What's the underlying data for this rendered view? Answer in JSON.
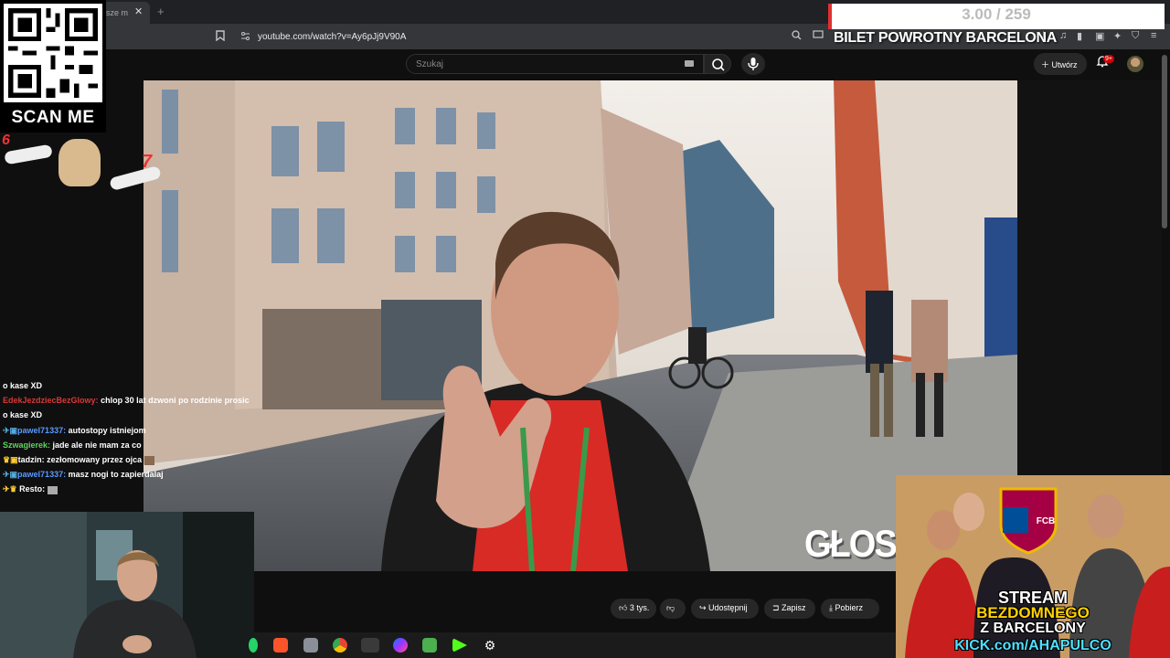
{
  "browser": {
    "tab_title": "sze m",
    "url": "youtube.com/watch?v=Ay6pJj9V90A"
  },
  "youtube": {
    "search_placeholder": "Szukaj",
    "create_label": "Utwórz",
    "notification_count": "9+",
    "actions": {
      "likes": "3 tys.",
      "share": "Udostępnij",
      "save": "Zapisz",
      "download": "Pobierz"
    }
  },
  "overlay": {
    "qr_label": "SCAN ME",
    "counter": "3.00 / 259",
    "goal_title": "BILET POWROTNY BARCELONA",
    "reward_left": "6",
    "reward_right": "7"
  },
  "chat": [
    {
      "user": "",
      "user_color": "#ffffff",
      "text": "o kase XD"
    },
    {
      "user": "EdekJezdziecBezGlowy:",
      "user_color": "#d63a3a",
      "text": "chlop 30 lat dzwoni po rodzinie prosic"
    },
    {
      "user": "",
      "user_color": "#ffffff",
      "text": "o kase XD"
    },
    {
      "user": "pawel71337:",
      "user_color": "#5b9bff",
      "text": "autostopy istniejom"
    },
    {
      "user": "Szwagierek:",
      "user_color": "#5fd35f",
      "text": "jade ale nie mam za co"
    },
    {
      "user": "tadzin:",
      "user_color": "#ffffff",
      "text": "zezłomowany przez ojca"
    },
    {
      "user": "pawel71337:",
      "user_color": "#5b9bff",
      "text": "masz nogi to zapierdalaj"
    },
    {
      "user": "Resto:",
      "user_color": "#ffffff",
      "text": ""
    }
  ],
  "video": {
    "caption": "GŁOS M"
  },
  "ad": {
    "line1": "STREAM",
    "line2": "BEZDOMNEGO",
    "line3": "Z BARCELONY",
    "line4": "KICK.com/AHAPULCO",
    "badge": "FCB"
  },
  "colors": {
    "accent_red": "#e03030",
    "youtube_bg": "#0f0f0f",
    "kick_green": "#53fc18"
  },
  "taskbar_icons": [
    "whatsapp-icon",
    "brave-icon",
    "files-icon",
    "chrome-icon",
    "obs-icon",
    "messenger-icon",
    "app-icon",
    "kick-icon",
    "settings-icon"
  ]
}
